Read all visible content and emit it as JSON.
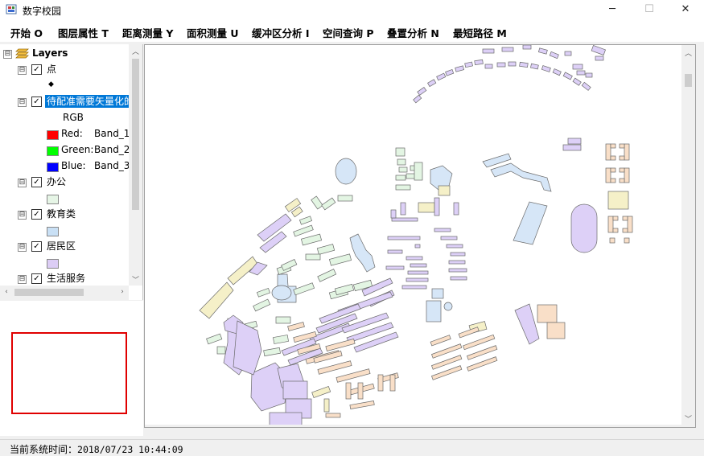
{
  "window": {
    "title": "数字校园",
    "minimize": "─",
    "maximize": "☐",
    "close": "✕"
  },
  "menu": [
    {
      "label": "开始 O"
    },
    {
      "label": "图层属性 T"
    },
    {
      "label": "距离测量 Y"
    },
    {
      "label": "面积测量 U"
    },
    {
      "label": "缓冲区分析 I"
    },
    {
      "label": "空间查询 P"
    },
    {
      "label": "叠置分析 N"
    },
    {
      "label": "最短路径 M"
    }
  ],
  "toc": {
    "root_label": "Layers",
    "layers": [
      {
        "name": "点",
        "checked": true,
        "expander": "⊟"
      },
      {
        "name": "待配准需要矢量化的",
        "checked": true,
        "expander": "⊟",
        "selected": true
      },
      {
        "name": "办公",
        "checked": true,
        "expander": "⊟"
      },
      {
        "name": "教育类",
        "checked": true,
        "expander": "⊟"
      },
      {
        "name": "居民区",
        "checked": true,
        "expander": "⊟"
      },
      {
        "name": "生活服务",
        "checked": true,
        "expander": "⊟"
      }
    ],
    "rgb_label": "RGB",
    "bands": [
      {
        "channel": "Red:",
        "band": "Band_1",
        "color": "#ff0000"
      },
      {
        "channel": "Green:",
        "band": "Band_2",
        "color": "#00ff00"
      },
      {
        "channel": "Blue:",
        "band": "Band_3",
        "color": "#0000ff"
      }
    ],
    "symbols": {
      "point": "◆",
      "office_color": "#e6f5e6",
      "education_color": "#c9e0f5",
      "residential_color": "#dccdf5"
    },
    "check_mark": "✓"
  },
  "overview": {
    "extent_color": "#e00000"
  },
  "map": {
    "colors": {
      "education": "#d6e6f7",
      "residential": "#ddd0f7",
      "office": "#e3f5e3",
      "service": "#f9dfc8",
      "yellow": "#f5f0c8"
    }
  },
  "status": {
    "label": "当前系统时间：",
    "datetime": "2018/07/23 10:44:09"
  }
}
